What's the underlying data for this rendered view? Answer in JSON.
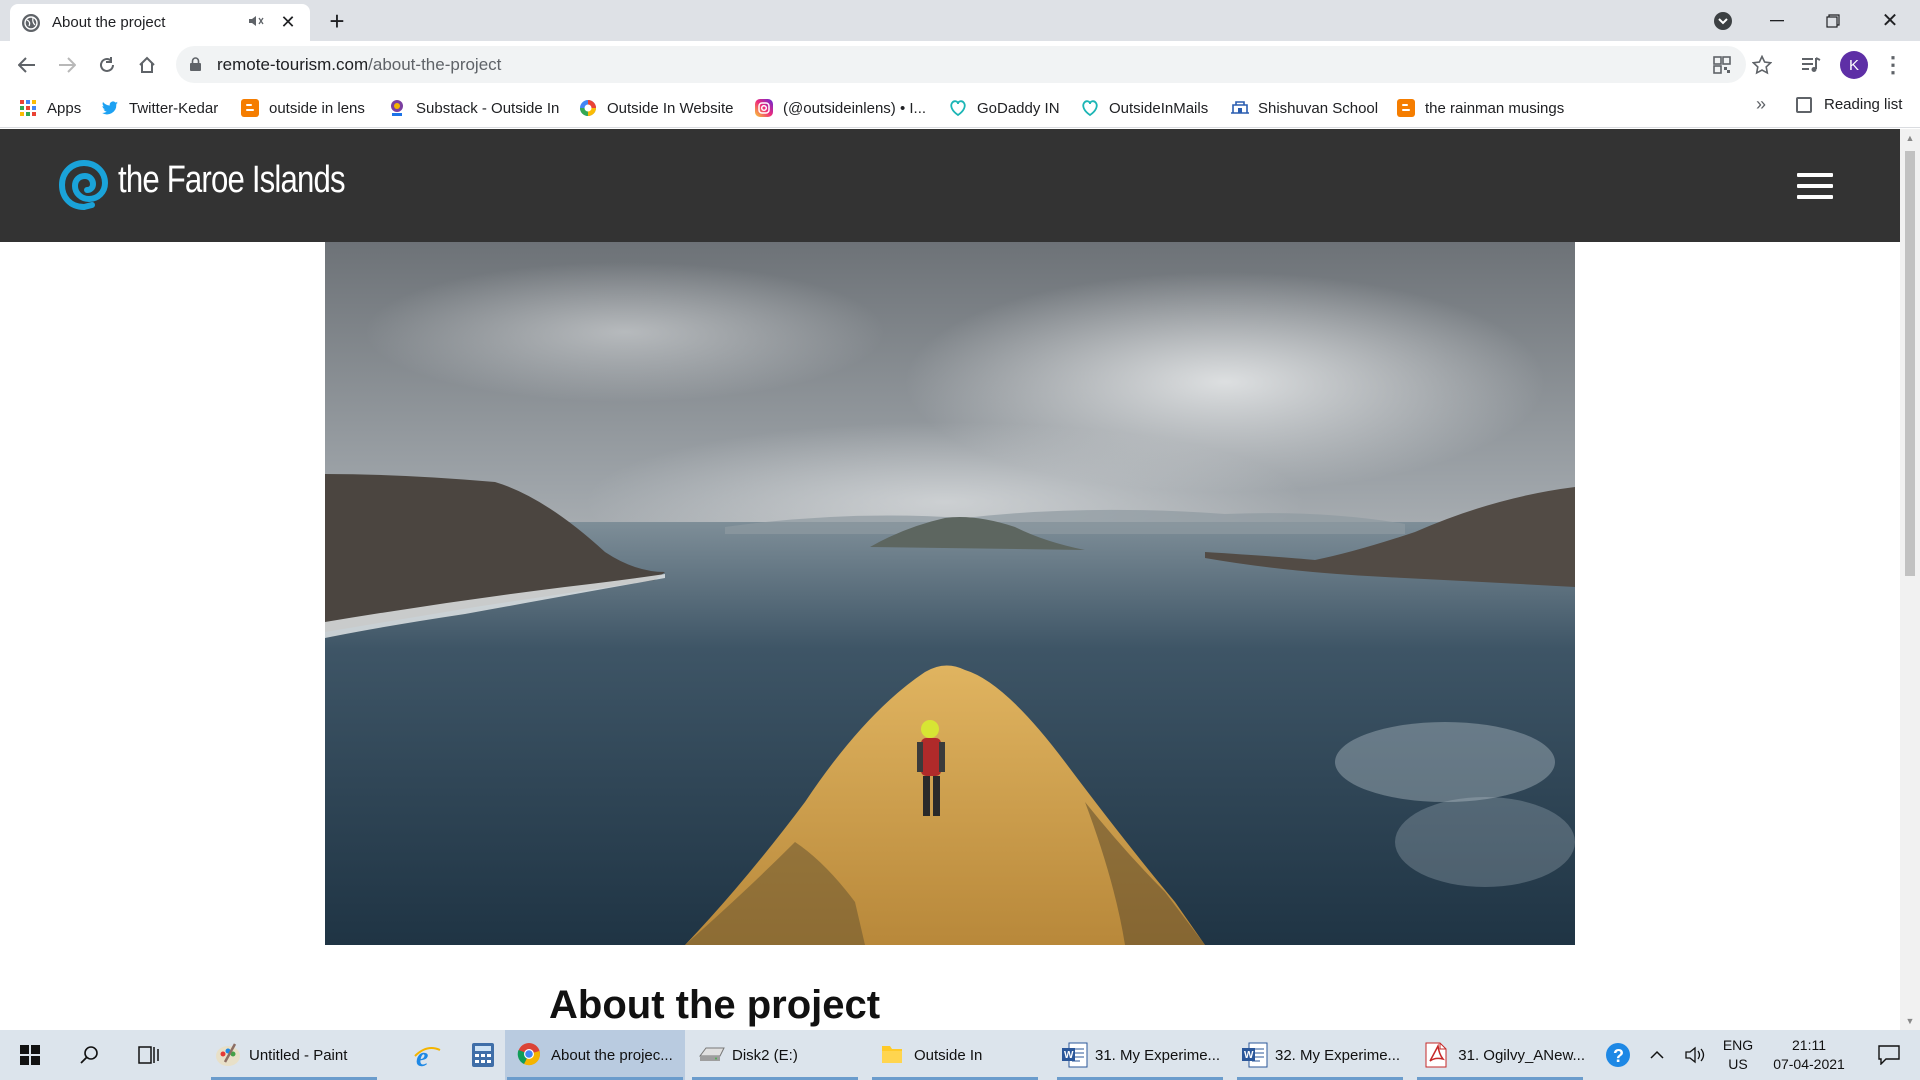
{
  "browser": {
    "tab_title": "About the project",
    "url_domain": "remote-tourism.com",
    "url_path": "/about-the-project",
    "profile_initial": "K"
  },
  "bookmarks": [
    {
      "label": "Apps",
      "icon": "apps-grid-icon",
      "color": "#4285f4"
    },
    {
      "label": "Twitter-Kedar",
      "icon": "twitter-bird-icon",
      "color": "#1da1f2"
    },
    {
      "label": "outside in lens",
      "icon": "blogger-icon",
      "color": "#f57d00"
    },
    {
      "label": "Substack - Outside In",
      "icon": "substack-icon",
      "color": "#7b3fa0"
    },
    {
      "label": "Outside In Website",
      "icon": "website-icon",
      "color": "#e94235"
    },
    {
      "label": "(@outsideinlens) • I...",
      "icon": "instagram-icon",
      "color": "#d6249f"
    },
    {
      "label": "GoDaddy IN",
      "icon": "godaddy-icon",
      "color": "#1bdbdb"
    },
    {
      "label": "OutsideInMails",
      "icon": "godaddy-icon",
      "color": "#1bdbdb"
    },
    {
      "label": "Shishuvan School",
      "icon": "school-icon",
      "color": "#2a5db0"
    },
    {
      "label": "the rainman musings",
      "icon": "blogger-icon",
      "color": "#f57d00"
    }
  ],
  "reading_list": "Reading list",
  "site": {
    "logo_text": "the Faroe Islands",
    "brand_color": "#1aa3d9",
    "header_color": "#333333",
    "page_heading": "About the project"
  },
  "taskbar": {
    "items": [
      {
        "label": "Untitled - Paint",
        "icon": "paint-icon",
        "active": false
      },
      {
        "label": "",
        "icon": "internet-explorer-icon",
        "active": false
      },
      {
        "label": "",
        "icon": "calculator-icon",
        "active": false
      },
      {
        "label": "About the projec...",
        "icon": "chrome-icon",
        "active": true
      },
      {
        "label": "Disk2 (E:)",
        "icon": "drive-icon",
        "active": false
      },
      {
        "label": "Outside In",
        "icon": "folder-icon",
        "active": false
      },
      {
        "label": "31. My Experime...",
        "icon": "word-doc-icon",
        "active": false
      },
      {
        "label": "32. My Experime...",
        "icon": "word-doc-icon",
        "active": false
      },
      {
        "label": "31. Ogilvy_ANew...",
        "icon": "pdf-icon",
        "active": false
      }
    ],
    "lang_top": "ENG",
    "lang_bottom": "US",
    "time": "21:11",
    "date": "07-04-2021"
  }
}
